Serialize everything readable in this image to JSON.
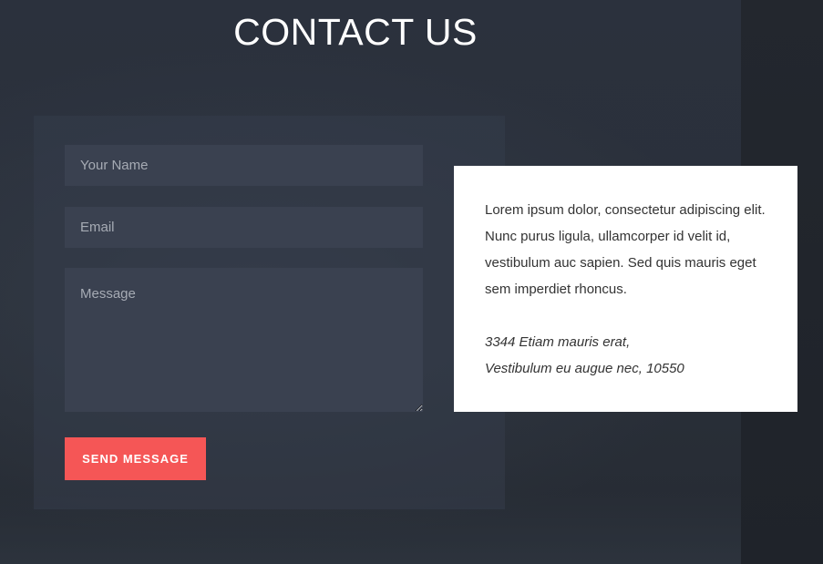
{
  "header": {
    "title": "CONTACT US"
  },
  "form": {
    "name_placeholder": "Your Name",
    "email_placeholder": "Email",
    "message_placeholder": "Message",
    "submit_label": "SEND MESSAGE"
  },
  "info": {
    "description": "Lorem ipsum dolor, consectetur adipiscing elit. Nunc purus ligula, ullamcorper id velit id, vestibulum auc sapien. Sed quis mauris eget sem imperdiet rhoncus.",
    "address_line1": "3344 Etiam mauris erat,",
    "address_line2": "Vestibulum eu augue nec, 10550"
  },
  "colors": {
    "accent": "#f55656",
    "background": "#2a303a",
    "field": "#3a4150",
    "card": "#ffffff"
  }
}
